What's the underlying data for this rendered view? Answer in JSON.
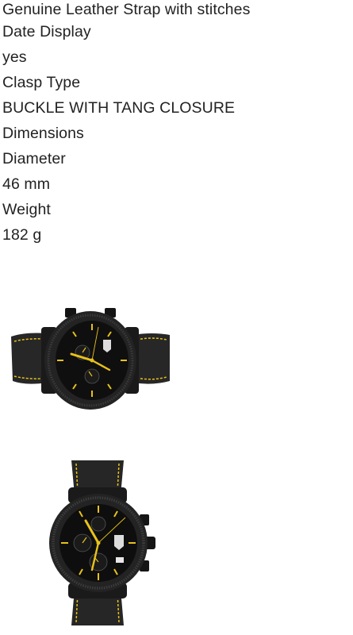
{
  "specs": [
    "Genuine Leather Strap with stitches",
    "Date Display",
    "yes",
    "Clasp Type",
    "BUCKLE WITH TANG CLOSURE",
    "Dimensions",
    "Diameter",
    "46 mm",
    "Weight",
    "182 g"
  ],
  "colors": {
    "text": "#222222",
    "background": "#ffffff",
    "watch_case": "#1c1c1c",
    "strap": "#262626",
    "accent_yellow": "#e8c21a"
  },
  "images": [
    {
      "subject": "black chronograph watch with black leather strap and yellow stitching, side view"
    },
    {
      "subject": "black chronograph watch with black leather strap and yellow stitching, front view"
    }
  ]
}
